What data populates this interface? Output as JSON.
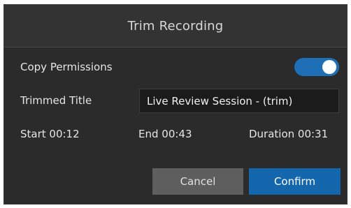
{
  "dialog": {
    "title": "Trim Recording",
    "copy_permissions": {
      "label": "Copy Permissions",
      "enabled": true
    },
    "trimmed_title": {
      "label": "Trimmed Title",
      "value": "Live Review Session - (trim)"
    },
    "times": {
      "start": "Start 00:12",
      "end": "End 00:43",
      "duration": "Duration 00:31"
    },
    "buttons": {
      "cancel": "Cancel",
      "confirm": "Confirm"
    }
  },
  "colors": {
    "accent": "#1466ad",
    "toggle_on": "#1f6fb6",
    "background": "#2b2b2b"
  }
}
